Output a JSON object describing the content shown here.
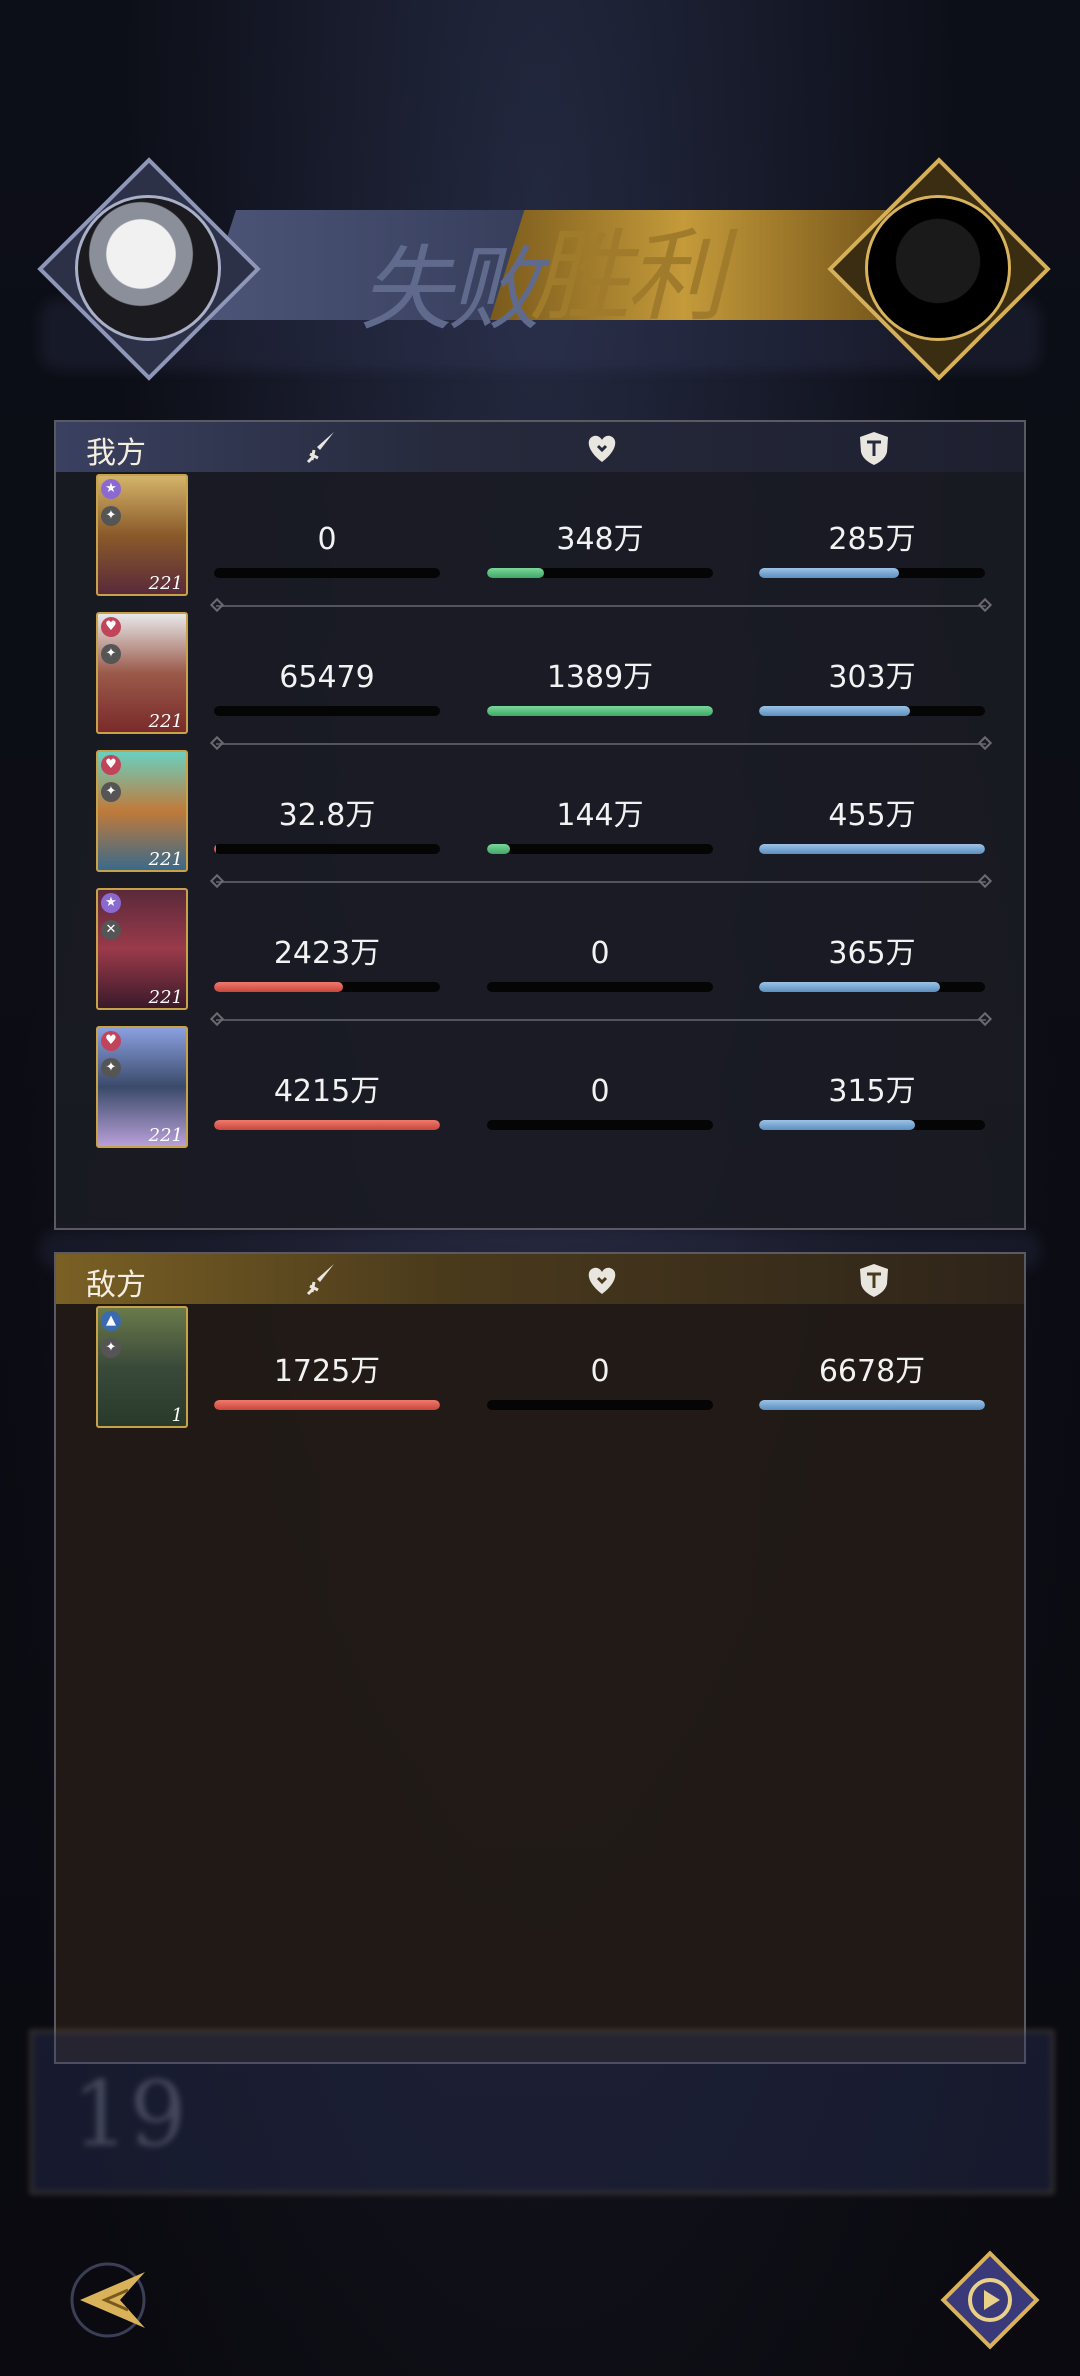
{
  "banner": {
    "lose_text": "失败",
    "win_text": "胜利"
  },
  "ally": {
    "title": "我方",
    "rows": [
      {
        "level": "221",
        "dmg": "0",
        "dmg_pct": 0,
        "heal": "348万",
        "heal_pct": 25,
        "def": "285万",
        "def_pct": 62,
        "card_color": "#b08a3a"
      },
      {
        "level": "221",
        "dmg": "65479",
        "dmg_pct": 0,
        "heal": "1389万",
        "heal_pct": 100,
        "def": "303万",
        "def_pct": 67,
        "card_color": "#8a3b3b"
      },
      {
        "level": "221",
        "dmg": "32.8万",
        "dmg_pct": 1,
        "heal": "144万",
        "heal_pct": 10,
        "def": "455万",
        "def_pct": 100,
        "card_color": "#3f8a7a"
      },
      {
        "level": "221",
        "dmg": "2423万",
        "dmg_pct": 57,
        "heal": "0",
        "heal_pct": 0,
        "def": "365万",
        "def_pct": 80,
        "card_color": "#7a2c3a"
      },
      {
        "level": "221",
        "dmg": "4215万",
        "dmg_pct": 100,
        "heal": "0",
        "heal_pct": 0,
        "def": "315万",
        "def_pct": 69,
        "card_color": "#6a7ab8"
      }
    ]
  },
  "enemy": {
    "title": "敌方",
    "rows": [
      {
        "level": "1",
        "dmg": "1725万",
        "dmg_pct": 100,
        "heal": "0",
        "heal_pct": 0,
        "def": "6678万",
        "def_pct": 100,
        "card_color": "#4a5a3a"
      }
    ]
  },
  "background": {
    "rank_number": "19"
  },
  "icons": {
    "damage": "sword-icon",
    "heal": "heart-icon",
    "defense": "shield-icon",
    "back": "back-arrow-icon",
    "play": "play-icon"
  }
}
